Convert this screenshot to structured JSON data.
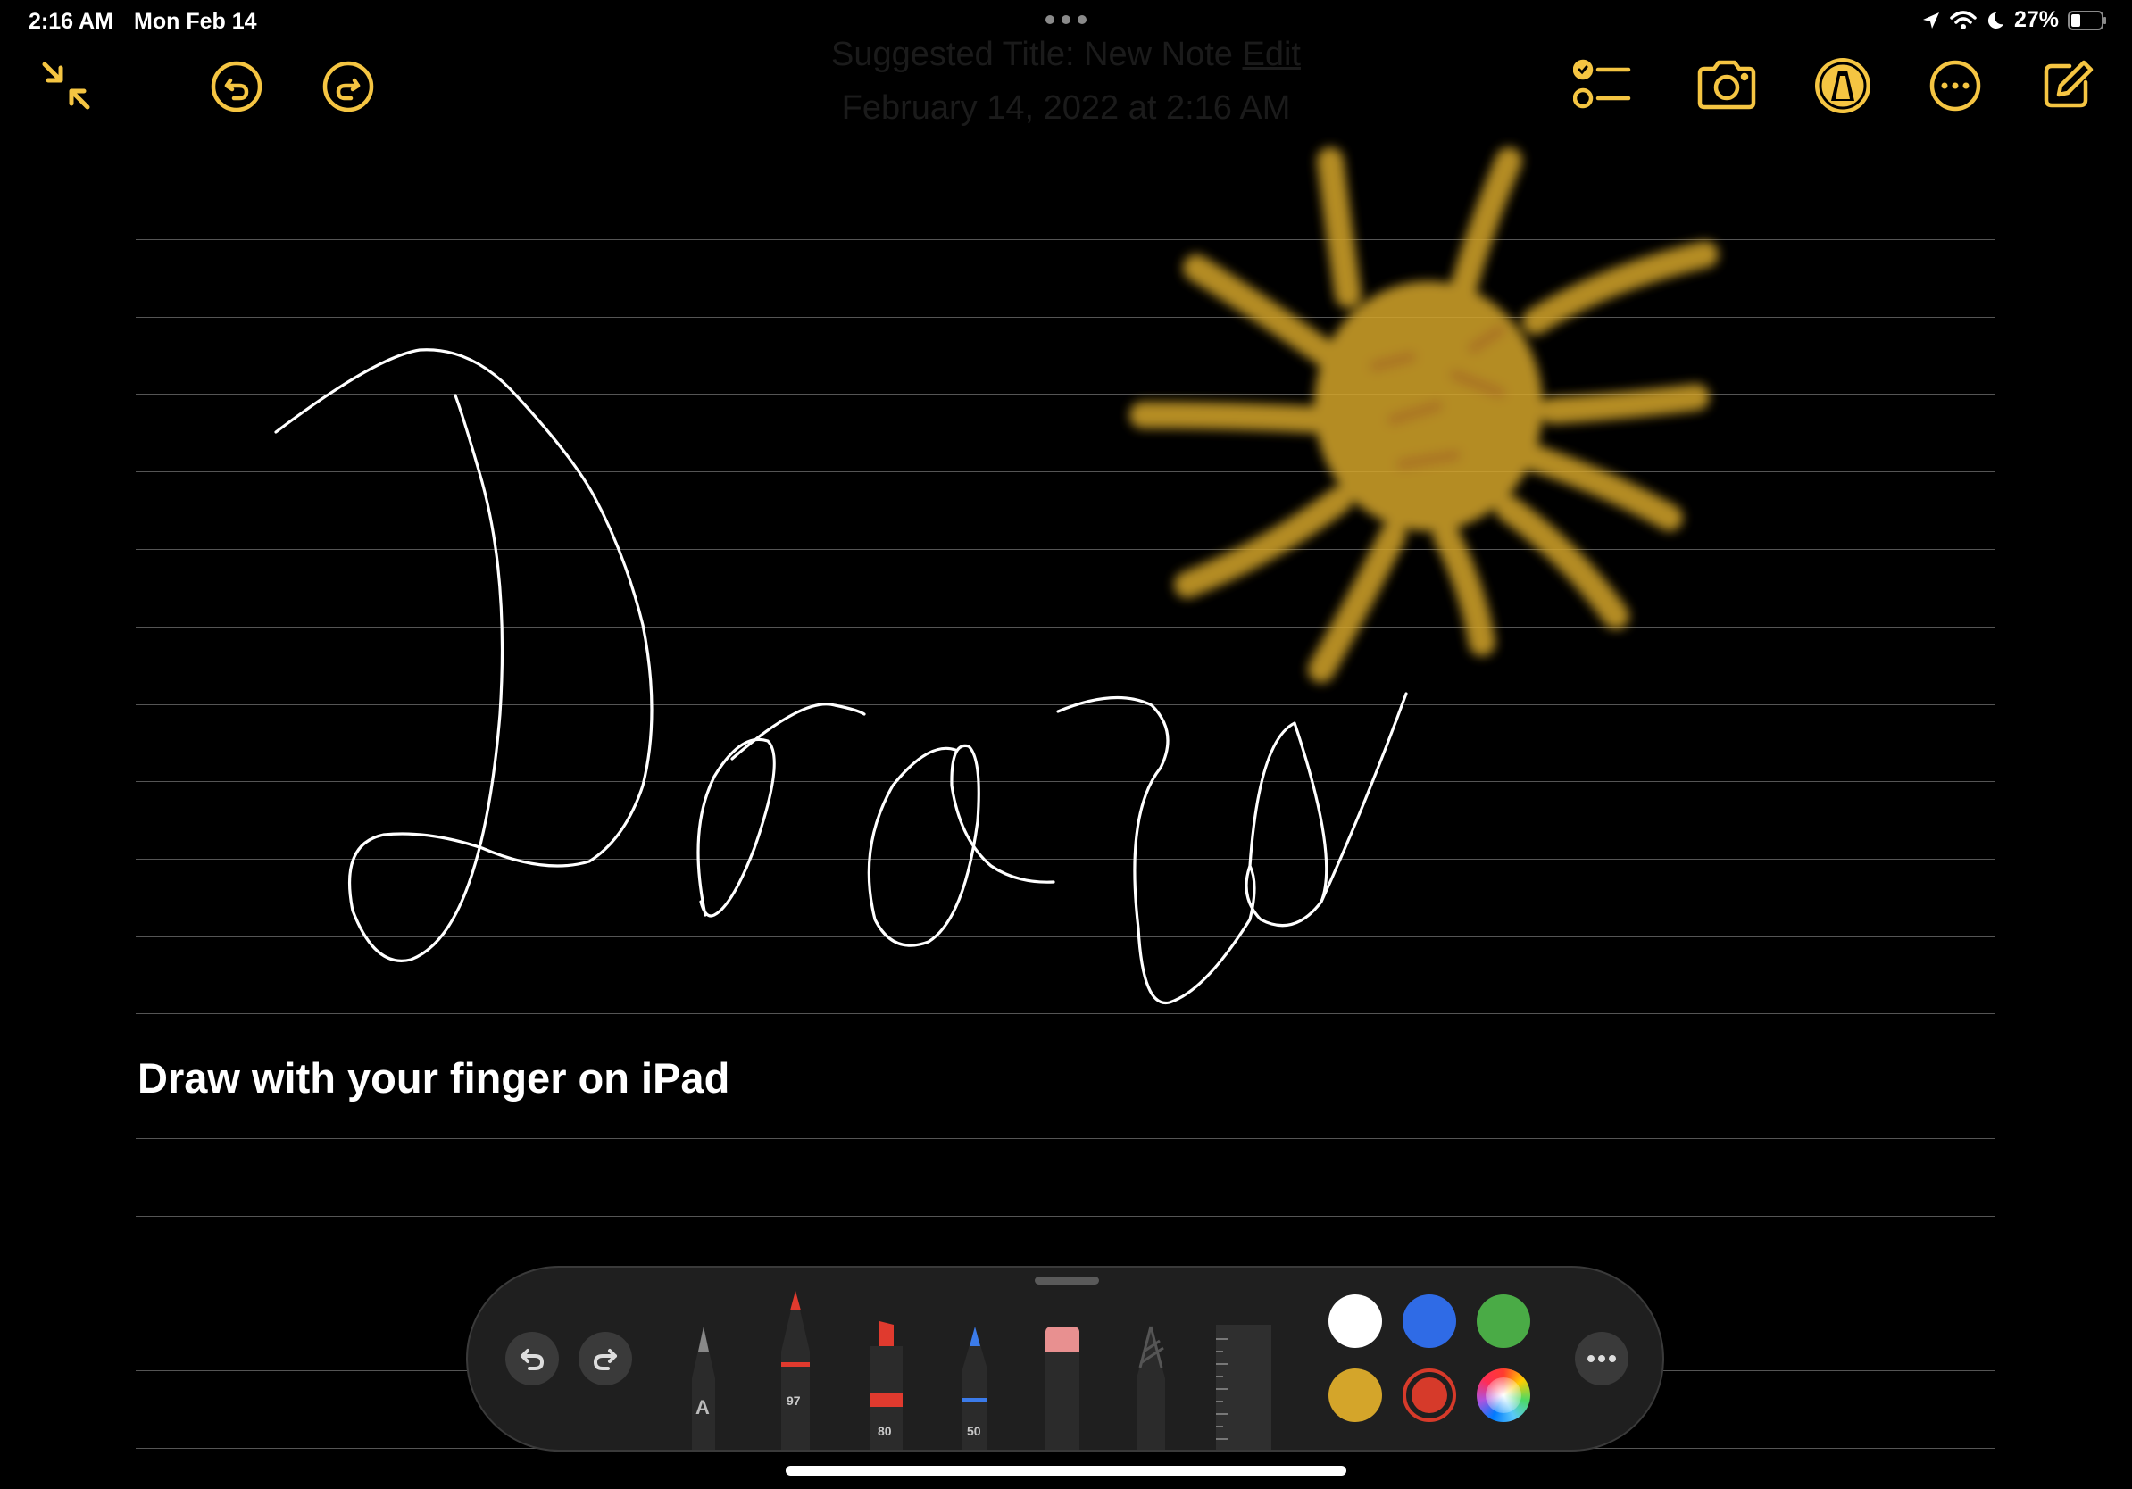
{
  "status_bar": {
    "time": "2:16 AM",
    "date": "Mon Feb 14",
    "battery": "27%"
  },
  "toolbar": {
    "left": [
      "collapse-icon",
      "undo-icon",
      "redo-icon"
    ],
    "right": [
      "checklist-icon",
      "camera-icon",
      "markup-icon",
      "more-icon",
      "compose-icon"
    ],
    "accent": "#f5c542"
  },
  "note": {
    "title_prefix": "Suggested Title: New Note",
    "title_edit": "Edit",
    "date": "February 14, 2022 at 2:16 AM",
    "caption": "Draw with your finger on iPad"
  },
  "palette": {
    "tools": [
      {
        "name": "pen",
        "label": "A"
      },
      {
        "name": "marker",
        "label": "97"
      },
      {
        "name": "highlighter",
        "label": "80"
      },
      {
        "name": "pencil",
        "label": "50"
      },
      {
        "name": "eraser",
        "label": ""
      },
      {
        "name": "lasso",
        "label": ""
      },
      {
        "name": "ruler",
        "label": ""
      }
    ],
    "colors": [
      "#ffffff",
      "#2f6be6",
      "#4aab46",
      "#d4a52a",
      "#d63a2a"
    ],
    "selected_color": "#d63a2a"
  }
}
